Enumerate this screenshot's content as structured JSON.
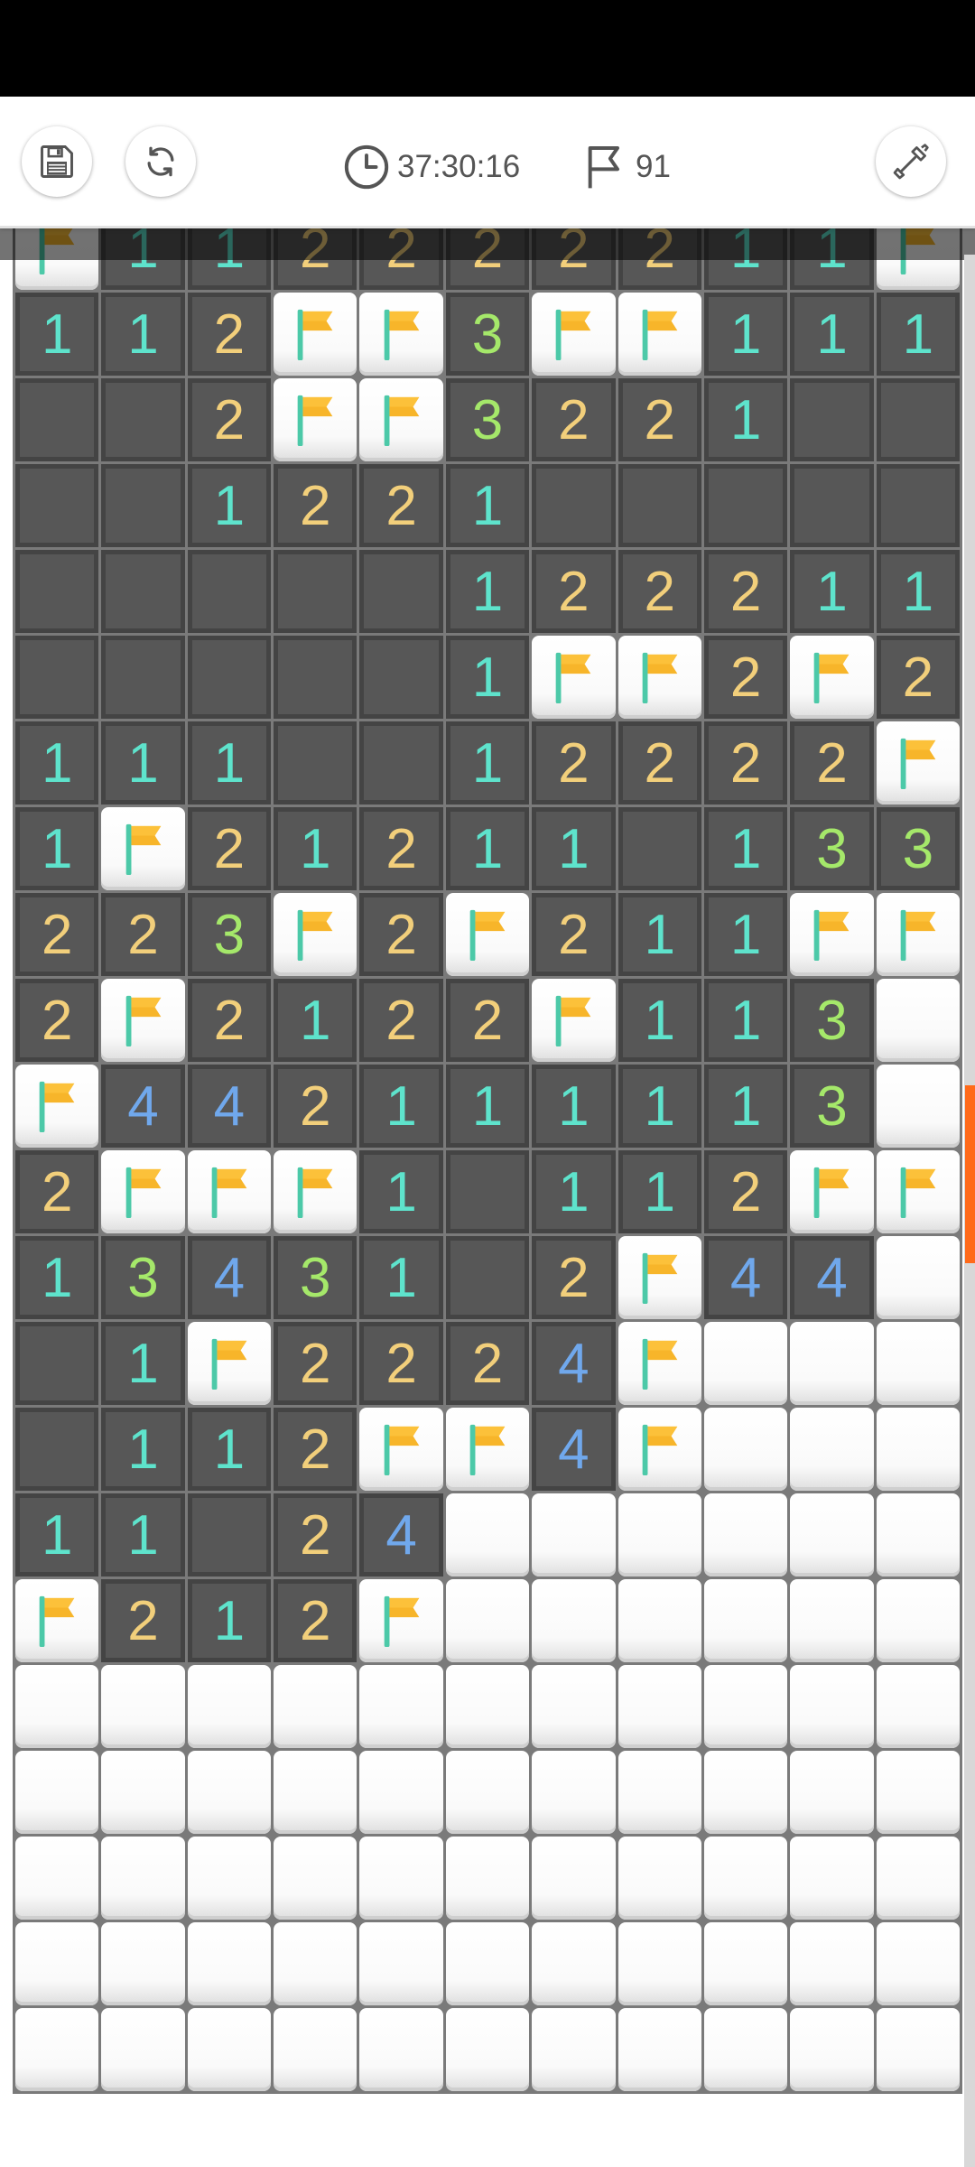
{
  "toolbar": {
    "timer": "37:30:16",
    "flags_remaining": "91",
    "buttons": [
      "save",
      "restart",
      "dig-tool"
    ]
  },
  "icons": {
    "save": "floppy-disk-icon",
    "restart": "refresh-icon",
    "timer": "clock-icon",
    "flags": "flag-outline-icon",
    "tool": "shovel-icon",
    "cell_flag": "flag-icon"
  },
  "colors": {
    "number_1": "#5ee3cc",
    "number_2": "#f2cf7b",
    "number_3": "#a5e86a",
    "number_4": "#70a8ec",
    "flag": "#f7b52a",
    "open_cell": "#575757",
    "scroll_thumb": "#ff6a1a"
  },
  "board": {
    "columns": 11,
    "legend": "F = flagged, H = unrevealed, 0 = revealed empty, digits = adjacent mines",
    "rows": [
      [
        "F",
        "1",
        "1",
        "2",
        "2",
        "2",
        "2",
        "2",
        "1",
        "1",
        "F"
      ],
      [
        "1",
        "1",
        "2",
        "F",
        "F",
        "3",
        "F",
        "F",
        "1",
        "1",
        "1"
      ],
      [
        "0",
        "0",
        "2",
        "F",
        "F",
        "3",
        "2",
        "2",
        "1",
        "0",
        "0"
      ],
      [
        "0",
        "0",
        "1",
        "2",
        "2",
        "1",
        "0",
        "0",
        "0",
        "0",
        "0"
      ],
      [
        "0",
        "0",
        "0",
        "0",
        "0",
        "1",
        "2",
        "2",
        "2",
        "1",
        "1"
      ],
      [
        "0",
        "0",
        "0",
        "0",
        "0",
        "1",
        "F",
        "F",
        "2",
        "F",
        "2"
      ],
      [
        "1",
        "1",
        "1",
        "0",
        "0",
        "1",
        "2",
        "2",
        "2",
        "2",
        "F"
      ],
      [
        "1",
        "F",
        "2",
        "1",
        "2",
        "1",
        "1",
        "0",
        "1",
        "3",
        "3"
      ],
      [
        "2",
        "2",
        "3",
        "F",
        "2",
        "F",
        "2",
        "1",
        "1",
        "F",
        "F"
      ],
      [
        "2",
        "F",
        "2",
        "1",
        "2",
        "2",
        "F",
        "1",
        "1",
        "3",
        "H"
      ],
      [
        "F",
        "4",
        "4",
        "2",
        "1",
        "1",
        "1",
        "1",
        "1",
        "3",
        "H"
      ],
      [
        "2",
        "F",
        "F",
        "F",
        "1",
        "0",
        "1",
        "1",
        "2",
        "F",
        "F"
      ],
      [
        "1",
        "3",
        "4",
        "3",
        "1",
        "0",
        "2",
        "F",
        "4",
        "4",
        "H"
      ],
      [
        "0",
        "1",
        "F",
        "2",
        "2",
        "2",
        "4",
        "F",
        "H",
        "H",
        "H"
      ],
      [
        "0",
        "1",
        "1",
        "2",
        "F",
        "F",
        "4",
        "F",
        "H",
        "H",
        "H"
      ],
      [
        "1",
        "1",
        "0",
        "2",
        "4",
        "H",
        "H",
        "H",
        "H",
        "H",
        "H"
      ],
      [
        "F",
        "2",
        "1",
        "2",
        "F",
        "H",
        "H",
        "H",
        "H",
        "H",
        "H"
      ],
      [
        "H",
        "H",
        "H",
        "H",
        "H",
        "H",
        "H",
        "H",
        "H",
        "H",
        "H"
      ],
      [
        "H",
        "H",
        "H",
        "H",
        "H",
        "H",
        "H",
        "H",
        "H",
        "H",
        "H"
      ],
      [
        "H",
        "H",
        "H",
        "H",
        "H",
        "H",
        "H",
        "H",
        "H",
        "H",
        "H"
      ],
      [
        "H",
        "H",
        "H",
        "H",
        "H",
        "H",
        "H",
        "H",
        "H",
        "H",
        "H"
      ],
      [
        "H",
        "H",
        "H",
        "H",
        "H",
        "H",
        "H",
        "H",
        "H",
        "H",
        "H"
      ]
    ]
  }
}
